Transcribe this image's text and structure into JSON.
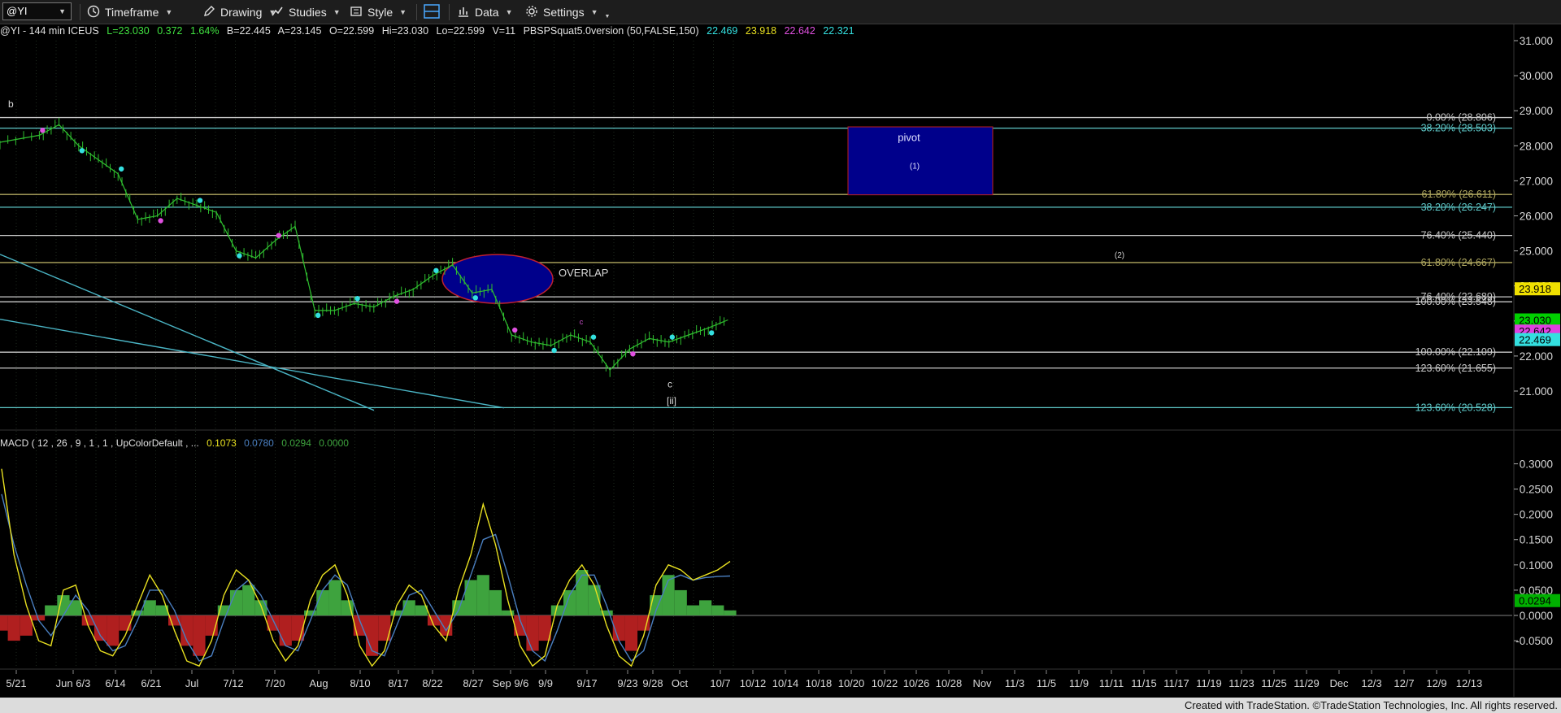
{
  "toolbar": {
    "symbol": "@YI",
    "timeframe": "Timeframe",
    "drawing": "Drawing",
    "studies": "Studies",
    "style": "Style",
    "data": "Data",
    "settings": "Settings"
  },
  "info": {
    "symbol_line": "@YI - 144 min  ICEUS",
    "last": "L=23.030",
    "change": "0.372",
    "pct": "1.64%",
    "bid": "B=22.445",
    "ask": "A=23.145",
    "open": "O=22.599",
    "high": "Hi=23.030",
    "low": "Lo=22.599",
    "volume": "V=11",
    "indicator": "PBSPSquat5.0version (50,FALSE,150)",
    "ind_values": [
      "22.469",
      "23.918",
      "22.642",
      "22.321"
    ]
  },
  "macd_info": {
    "label": "MACD ( 12 , 26 , 9 , 1 , 1 , UpColorDefault , ...",
    "values": [
      "0.1073",
      "0.0780",
      "0.0294",
      "0.0000"
    ]
  },
  "colors": {
    "background": "#000000",
    "fib_white": "#c8c8c8",
    "fib_olive": "#b0a860",
    "fib_teal": "#5ec8c8",
    "pivot_fill": "#00008b",
    "hist_up": "#3ea33e",
    "hist_down": "#b01f1f",
    "macd_line": "#e8e020",
    "signal_line": "#4a7fc0",
    "price_bar": "#2fbf2f",
    "dot_cyan": "#34e0e0",
    "dot_magenta": "#e050e0",
    "trend_line": "#4ab4c4"
  },
  "footer": "Created with TradeStation. ©TradeStation Technologies, Inc. All rights reserved.",
  "chart_data": [
    {
      "type": "line",
      "title": "@YI - 144 min ICEUS",
      "x_tick_labels": [
        "5/21",
        "Jun 6/3",
        "6/14",
        "6/21",
        "Jul",
        "7/12",
        "7/20",
        "Aug",
        "8/10",
        "8/17",
        "8/22",
        "8/27",
        "Sep 9/6",
        "9/9",
        "9/17",
        "9/23",
        "9/28",
        "Oct",
        "10/7",
        "10/12",
        "10/14",
        "10/18",
        "10/20",
        "10/22",
        "10/26",
        "10/28",
        "Nov",
        "11/3",
        "11/5",
        "11/9",
        "11/11",
        "11/15",
        "11/17",
        "11/19",
        "11/23",
        "11/25",
        "11/29",
        "Dec",
        "12/3",
        "12/7",
        "12/9",
        "12/13"
      ],
      "y_ticks": [
        "31.000",
        "30.000",
        "29.000",
        "28.000",
        "27.000",
        "26.000",
        "25.000",
        "24.000",
        "23.000",
        "22.000",
        "21.000"
      ],
      "ylim": [
        20.5,
        31.3
      ],
      "price_path": {
        "x_index": [
          0,
          1,
          1.5,
          2,
          2.5,
          3,
          3.5,
          4,
          4.5,
          5,
          5.5,
          6,
          6.5,
          7,
          7.5,
          8,
          8.5,
          9,
          9.5,
          10,
          10.5,
          11,
          11.5,
          12,
          12.5,
          13,
          13.5,
          14,
          14.5,
          15,
          15.5,
          16,
          16.5,
          17,
          17.5,
          18,
          18.5
        ],
        "y": [
          28.1,
          28.3,
          28.6,
          28.0,
          27.6,
          27.2,
          25.9,
          26.0,
          26.5,
          26.3,
          26.1,
          25.0,
          24.8,
          25.3,
          25.7,
          23.3,
          23.3,
          23.5,
          23.4,
          23.7,
          23.9,
          24.3,
          24.6,
          23.8,
          23.9,
          22.6,
          22.4,
          22.3,
          22.6,
          22.4,
          21.6,
          22.2,
          22.5,
          22.4,
          22.6,
          22.8,
          23.03
        ]
      },
      "horizontal_levels": [
        {
          "label": "0.00% (28.806)",
          "value": 28.806,
          "color": "white"
        },
        {
          "label": "38.20% (28.503)",
          "value": 28.503,
          "color": "teal"
        },
        {
          "label": "61.80% (26.611)",
          "value": 26.611,
          "color": "olive"
        },
        {
          "label": "38.20% (26.247)",
          "value": 26.247,
          "color": "teal"
        },
        {
          "label": "76.40% (25.440)",
          "value": 25.44,
          "color": "white"
        },
        {
          "label": "61.80% (24.667)",
          "value": 24.667,
          "color": "olive"
        },
        {
          "label": "76.40% (23.689)",
          "value": 23.689,
          "color": "white"
        },
        {
          "label": "100.00% (23.548)",
          "value": 23.548,
          "color": "white"
        },
        {
          "label": "100.00% (22.109)",
          "value": 22.109,
          "color": "white"
        },
        {
          "label": "123.60% (21.655)",
          "value": 21.655,
          "color": "white"
        },
        {
          "label": "123.60% (20.528)",
          "value": 20.528,
          "color": "teal"
        }
      ],
      "annotations": {
        "pivot": "pivot",
        "wave1": "(1)",
        "wave2": "(2)",
        "overlap": "OVERLAP",
        "b": "b",
        "c": "c",
        "c_small": "c",
        "ii": "[ii]"
      },
      "price_tags": [
        {
          "value": "23.918",
          "bg": "#f0e000",
          "fg": "#000000"
        },
        {
          "value": "23.030",
          "bg": "#00d000",
          "fg": "#000000"
        },
        {
          "value": "22.642",
          "bg": "#e040e0",
          "fg": "#000000"
        },
        {
          "value": "22.469",
          "bg": "#34e0e0",
          "fg": "#000000"
        }
      ]
    },
    {
      "type": "bar",
      "title": "MACD ( 12 , 26 , 9 , 1 , 1 , UpColorDefault , ...",
      "y_ticks": [
        "0.3000",
        "0.2500",
        "0.2000",
        "0.1500",
        "0.1000",
        "0.0500",
        "0.0000",
        "-0.0500"
      ],
      "ylim": [
        -0.085,
        0.33
      ],
      "histogram": [
        -0.03,
        -0.05,
        -0.04,
        -0.01,
        0.02,
        0.04,
        0.03,
        -0.02,
        -0.05,
        -0.06,
        -0.03,
        0.01,
        0.03,
        0.02,
        -0.02,
        -0.06,
        -0.08,
        -0.04,
        0.02,
        0.05,
        0.06,
        0.03,
        -0.03,
        -0.06,
        -0.05,
        0.01,
        0.05,
        0.07,
        0.03,
        -0.04,
        -0.08,
        -0.05,
        0.01,
        0.03,
        0.02,
        -0.02,
        -0.04,
        0.03,
        0.07,
        0.08,
        0.05,
        0.01,
        -0.04,
        -0.07,
        -0.05,
        0.02,
        0.05,
        0.09,
        0.06,
        0.01,
        -0.05,
        -0.07,
        -0.03,
        0.04,
        0.08,
        0.05,
        0.02,
        0.03,
        0.02,
        0.01
      ],
      "macd_line": [
        0.29,
        0.12,
        0.02,
        -0.05,
        -0.06,
        0.05,
        0.06,
        -0.02,
        -0.07,
        -0.08,
        -0.04,
        0.02,
        0.08,
        0.04,
        -0.03,
        -0.09,
        -0.1,
        -0.05,
        0.04,
        0.09,
        0.07,
        0.02,
        -0.05,
        -0.09,
        -0.06,
        0.03,
        0.08,
        0.1,
        0.04,
        -0.06,
        -0.1,
        -0.07,
        0.02,
        0.06,
        0.04,
        -0.02,
        -0.05,
        0.05,
        0.12,
        0.22,
        0.14,
        0.03,
        -0.06,
        -0.1,
        -0.08,
        0.02,
        0.07,
        0.1,
        0.06,
        -0.02,
        -0.08,
        -0.1,
        -0.04,
        0.06,
        0.1,
        0.09,
        0.07,
        0.08,
        0.09,
        0.107
      ],
      "signal_line": [
        0.24,
        0.14,
        0.06,
        -0.01,
        -0.04,
        0.0,
        0.04,
        0.01,
        -0.04,
        -0.07,
        -0.06,
        -0.01,
        0.05,
        0.05,
        0.01,
        -0.05,
        -0.09,
        -0.08,
        -0.01,
        0.05,
        0.07,
        0.04,
        -0.01,
        -0.06,
        -0.07,
        -0.01,
        0.05,
        0.08,
        0.06,
        -0.01,
        -0.07,
        -0.08,
        -0.02,
        0.04,
        0.05,
        0.01,
        -0.03,
        0.01,
        0.08,
        0.15,
        0.16,
        0.08,
        -0.01,
        -0.07,
        -0.09,
        -0.03,
        0.04,
        0.08,
        0.08,
        0.02,
        -0.05,
        -0.09,
        -0.07,
        0.01,
        0.07,
        0.08,
        0.07,
        0.075,
        0.077,
        0.078
      ]
    }
  ]
}
